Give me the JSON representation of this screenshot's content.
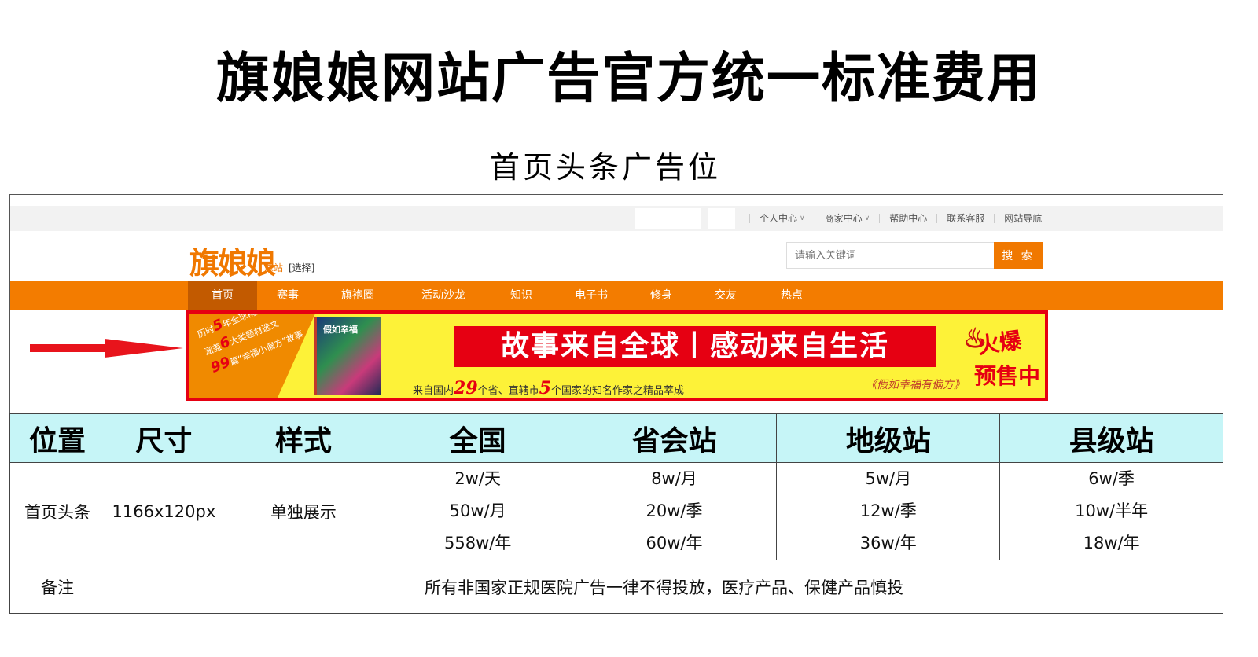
{
  "title": "旗娘娘网站广告官方统一标准费用",
  "subtitle": "首页头条广告位",
  "site": {
    "topbar_links": [
      {
        "label": "个人中心",
        "dropdown": true
      },
      {
        "label": "商家中心",
        "dropdown": true
      },
      {
        "label": "帮助中心",
        "dropdown": false
      },
      {
        "label": "联系客服",
        "dropdown": false
      },
      {
        "label": "网站导航",
        "dropdown": false
      }
    ],
    "logo": "旗娘娘",
    "logo_sub": "总站",
    "logo_select": "[选择]",
    "search_placeholder": "请输入关键词",
    "search_button": "搜 索",
    "nav": [
      "首页",
      "赛事",
      "旗袍圈",
      "活动沙龙",
      "知识",
      "电子书",
      "修身",
      "交友",
      "热点"
    ],
    "active_nav": 0,
    "brand_color": "#f37c00",
    "banner": {
      "promo_lines": [
        {
          "pre": "历时",
          "num": "5",
          "post": "年全球精选"
        },
        {
          "pre": "涵盖",
          "num": "6",
          "post": "大类题材选文"
        },
        {
          "pre": "",
          "num": "99",
          "post": "篇“幸福小偏方”故事"
        }
      ],
      "book_title": "假如幸福",
      "headline": "故事来自全球丨感动来自生活",
      "tagline_pre": "来自国内",
      "tagline_num1": "29",
      "tagline_mid": "个省、直辖市",
      "tagline_num2": "5",
      "tagline_post": "个国家的知名作家之精品萃成",
      "book_name": "《假如幸福有偏方》",
      "badge_1": "火爆",
      "badge_2": "预售中"
    }
  },
  "table": {
    "headers": [
      "位置",
      "尺寸",
      "样式",
      "全国",
      "省会站",
      "地级站",
      "县级站"
    ],
    "row": {
      "position": "首页头条",
      "size": "1166x120px",
      "style": "单独展示",
      "national": [
        "2w/天",
        "50w/月",
        "558w/年"
      ],
      "provincial": [
        "8w/月",
        "20w/季",
        "60w/年"
      ],
      "prefecture": [
        "5w/月",
        "12w/季",
        "36w/年"
      ],
      "county": [
        "6w/季",
        "10w/半年",
        "18w/年"
      ]
    },
    "note_label": "备注",
    "note_text": "所有非国家正规医院广告一律不得投放，医疗产品、保健产品慎投"
  }
}
